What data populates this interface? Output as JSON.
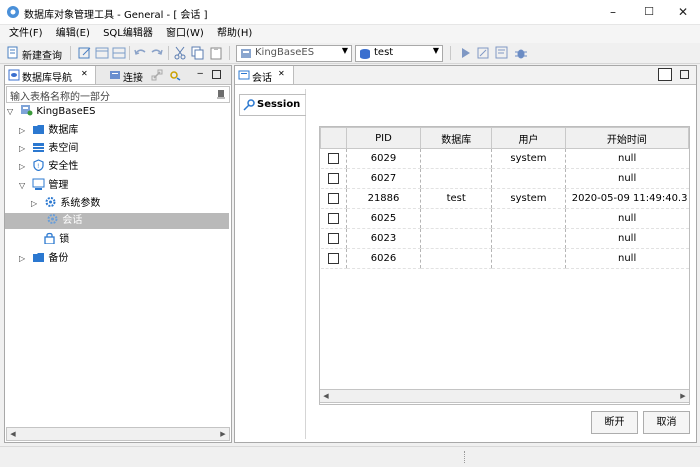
{
  "window": {
    "title": "数据库对象管理工具 - General - [ 会话 ]",
    "minimize": "–",
    "maximize": "☐",
    "close": "✕"
  },
  "menu": [
    "文件(F)",
    "编辑(E)",
    "SQL编辑器",
    "窗口(W)",
    "帮助(H)"
  ],
  "toolbar": {
    "new_query": "新建查询",
    "server_combo": "KingBaseES",
    "database_combo": "test"
  },
  "navigator": {
    "tab_label": "数据库导航",
    "tab_close": "✕",
    "connect_tab": "连接",
    "filter_placeholder": "输入表格名称的一部分",
    "tree": [
      {
        "label": "KingBaseES",
        "level": 0,
        "twisty": "▽",
        "icon": "server-icon"
      },
      {
        "label": "数据库",
        "level": 1,
        "twisty": "▷",
        "icon": "folder-icon"
      },
      {
        "label": "表空间",
        "level": 1,
        "twisty": "▷",
        "icon": "tablespace-icon"
      },
      {
        "label": "安全性",
        "level": 1,
        "twisty": "▷",
        "icon": "shield-icon"
      },
      {
        "label": "管理",
        "level": 1,
        "twisty": "▽",
        "icon": "manage-icon"
      },
      {
        "label": "系统参数",
        "level": 2,
        "twisty": "▷",
        "icon": "gear-icon"
      },
      {
        "label": "会话",
        "level": 2,
        "twisty": "",
        "icon": "session-icon",
        "selected": true
      },
      {
        "label": "锁",
        "level": 2,
        "twisty": "",
        "icon": "lock-icon"
      },
      {
        "label": "备份",
        "level": 1,
        "twisty": "▷",
        "icon": "folder-icon"
      }
    ]
  },
  "editor": {
    "tab_label": "会话",
    "tab_close": "✕",
    "side_tab": "Session",
    "columns": [
      "PID",
      "数据库",
      "用户",
      "开始时间"
    ],
    "rows": [
      {
        "pid": "6029",
        "db": "",
        "user": "system",
        "start": "null"
      },
      {
        "pid": "6027",
        "db": "",
        "user": "",
        "start": "null"
      },
      {
        "pid": "21886",
        "db": "test",
        "user": "system",
        "start": "2020-05-09 11:49:40.3"
      },
      {
        "pid": "6025",
        "db": "",
        "user": "",
        "start": "null"
      },
      {
        "pid": "6023",
        "db": "",
        "user": "",
        "start": "null"
      },
      {
        "pid": "6026",
        "db": "",
        "user": "",
        "start": "null"
      }
    ],
    "disconnect_button": "断开",
    "cancel_button": "取消"
  },
  "colors": {
    "selection": "#b9b9b9",
    "accent_blue": "#2b78d0"
  }
}
